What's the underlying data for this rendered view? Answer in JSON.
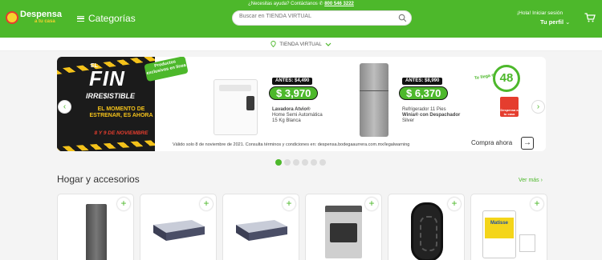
{
  "header": {
    "help_text": "¿Necesitas ayuda? Contáctanos",
    "phone": "800 546 3222",
    "logo_line1": "Despensa",
    "logo_line2": "a tu casa",
    "categories_label": "Categorías",
    "search_placeholder": "Buscar en TIENDA VIRTUAL",
    "greeting": "¡Hola! Iniciar sesión",
    "profile_label": "Tu perfil"
  },
  "store_selector": {
    "label": "TIENDA VIRTUAL"
  },
  "banner": {
    "el": "EL",
    "fin": "FIN",
    "irresistible": "IRRE$ISTIBLE",
    "momento": "EL MOMENTO DE ESTRENAR, ES AHORA",
    "fecha": "8 Y 9 DE NOVIEMBRE",
    "exclusive_tag": "Productos exclusivos en línea",
    "product1": {
      "antes": "ANTES: $4,490",
      "price": "$ 3,970",
      "name": "Lavadora Atvio®",
      "desc1": "Home Semi Automática",
      "desc2": "15 Kg Blanca"
    },
    "product2": {
      "antes": "ANTES: $8,990",
      "price": "$ 6,370",
      "name": "Refrigerador 11 Pies",
      "desc1": "Winia® con Despachador",
      "desc2": "Silver"
    },
    "delivery_prefix": "Te llega en",
    "delivery_hours": "48",
    "bag_text": "Despensa a tu casa",
    "legal": "Válido solo 8 de noviembre de 2021. Consulta términos y condiciones en: despensa.bodegaaurrera.com.mx/legalwarning",
    "comprar": "Compra ahora"
  },
  "carousel": {
    "prev": "‹",
    "next": "›",
    "dot_count": 6,
    "active_dot": 1
  },
  "section": {
    "title": "Hogar y accesorios",
    "ver_mas": "Ver más ›"
  },
  "products": [
    {
      "type": "refrigerator"
    },
    {
      "type": "mattress"
    },
    {
      "type": "mattress"
    },
    {
      "type": "stove"
    },
    {
      "type": "tire"
    },
    {
      "type": "paint",
      "brand": "Matisse"
    }
  ],
  "colors": {
    "brand_green": "#4db82b",
    "accent_yellow": "#f7d22d",
    "accent_red": "#e53d2e"
  }
}
